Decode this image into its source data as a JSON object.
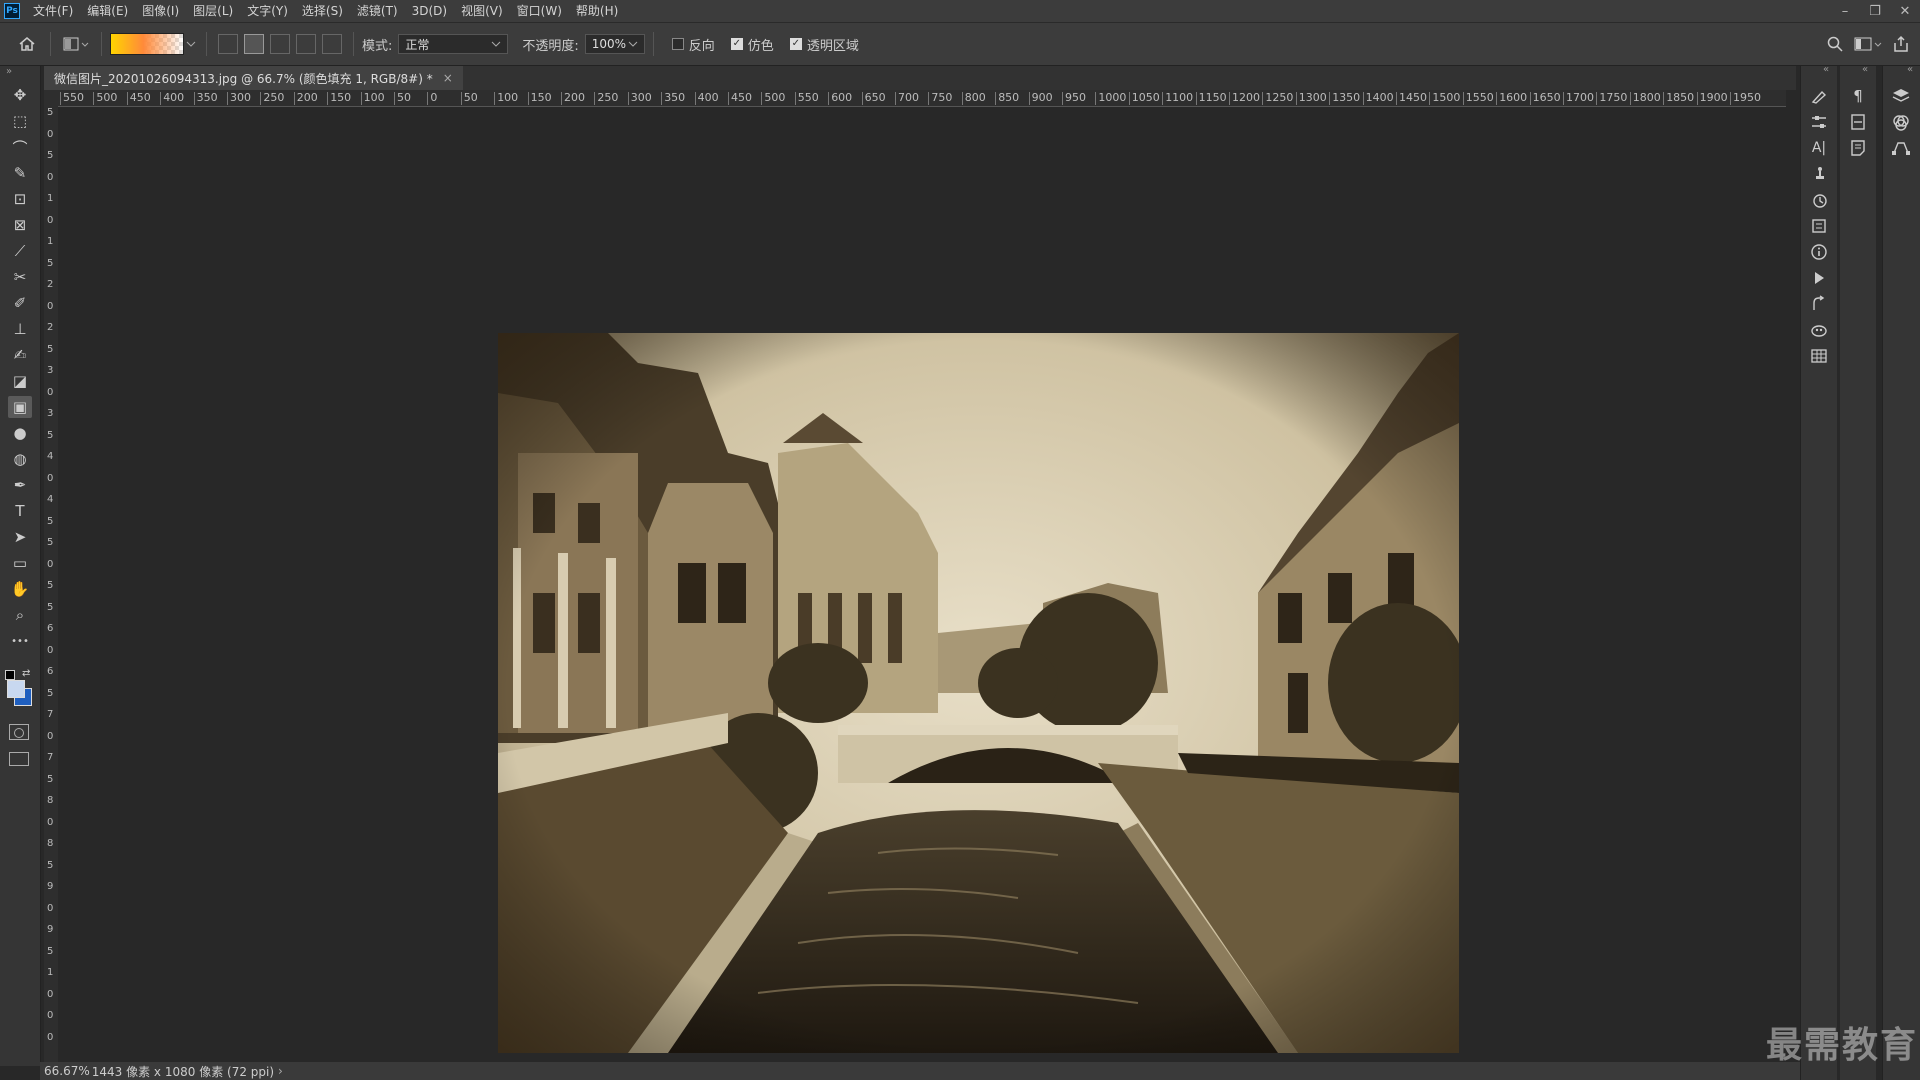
{
  "app": {
    "logo_text": "Ps"
  },
  "menu": {
    "items": [
      "文件(F)",
      "编辑(E)",
      "图像(I)",
      "图层(L)",
      "文字(Y)",
      "选择(S)",
      "滤镜(T)",
      "3D(D)",
      "视图(V)",
      "窗口(W)",
      "帮助(H)"
    ]
  },
  "window_controls": {
    "minimize": "–",
    "restore": "❐",
    "close": "✕"
  },
  "options": {
    "mode_label": "模式:",
    "mode_value": "正常",
    "opacity_label": "不透明度:",
    "opacity_value": "100%",
    "reverse_label": "反向",
    "reverse_checked": false,
    "dither_label": "仿色",
    "dither_checked": true,
    "transparency_label": "透明区域",
    "transparency_checked": true,
    "gradient_colors": [
      "#ffd400",
      "#ff8a3a",
      "transparent"
    ]
  },
  "document": {
    "tab_title": "微信图片_20201026094313.jpg @ 66.7% (颜色填充 1, RGB/8#) *",
    "close_glyph": "×"
  },
  "rulers": {
    "horizontal": [
      "550",
      "500",
      "450",
      "400",
      "350",
      "300",
      "250",
      "200",
      "150",
      "100",
      "50",
      "0",
      "50",
      "100",
      "150",
      "200",
      "250",
      "300",
      "350",
      "400",
      "450",
      "500",
      "550",
      "600",
      "650",
      "700",
      "750",
      "800",
      "850",
      "900",
      "950",
      "1000",
      "1050",
      "1100",
      "1150",
      "1200",
      "1250",
      "1300",
      "1350",
      "1400",
      "1450",
      "1500",
      "1550",
      "1600",
      "1650",
      "1700",
      "1750",
      "1800",
      "1850",
      "1900",
      "1950"
    ],
    "vertical": [
      "5",
      "0",
      "5",
      "0",
      "1",
      "0",
      "1",
      "5",
      "2",
      "0",
      "2",
      "5",
      "3",
      "0",
      "3",
      "5",
      "4",
      "0",
      "4",
      "5",
      "5",
      "0",
      "5",
      "5",
      "6",
      "0",
      "6",
      "5",
      "7",
      "0",
      "7",
      "5",
      "8",
      "0",
      "8",
      "5",
      "9",
      "0",
      "9",
      "5",
      "1",
      "0",
      "0",
      "0"
    ]
  },
  "tools": [
    {
      "name": "move-tool-icon",
      "glyph": "✥"
    },
    {
      "name": "marquee-tool-icon",
      "glyph": "⬚"
    },
    {
      "name": "lasso-tool-icon",
      "glyph": "⌒"
    },
    {
      "name": "quick-select-tool-icon",
      "glyph": "✎"
    },
    {
      "name": "crop-tool-icon",
      "glyph": "⊡"
    },
    {
      "name": "frame-tool-icon",
      "glyph": "⊠"
    },
    {
      "name": "eyedropper-tool-icon",
      "glyph": "⟋"
    },
    {
      "name": "healing-tool-icon",
      "glyph": "✂"
    },
    {
      "name": "brush-tool-icon",
      "glyph": "✐"
    },
    {
      "name": "stamp-tool-icon",
      "glyph": "⊥"
    },
    {
      "name": "history-brush-tool-icon",
      "glyph": "✍"
    },
    {
      "name": "eraser-tool-icon",
      "glyph": "◪"
    },
    {
      "name": "gradient-tool-icon",
      "glyph": "▣"
    },
    {
      "name": "blur-tool-icon",
      "glyph": "●"
    },
    {
      "name": "dodge-tool-icon",
      "glyph": "◍"
    },
    {
      "name": "pen-tool-icon",
      "glyph": "✒"
    },
    {
      "name": "type-tool-icon",
      "glyph": "T"
    },
    {
      "name": "path-select-tool-icon",
      "glyph": "➤"
    },
    {
      "name": "rectangle-tool-icon",
      "glyph": "▭"
    },
    {
      "name": "hand-tool-icon",
      "glyph": "✋"
    },
    {
      "name": "zoom-tool-icon",
      "glyph": "⌕"
    },
    {
      "name": "more-tools-icon",
      "glyph": "•••"
    }
  ],
  "status": {
    "zoom": "66.67%",
    "info": "1443 像素 x 1080 像素 (72 ppi)",
    "arrow": "›"
  },
  "watermark": "最需教育",
  "colors": {
    "foreground": "#c8d8f0",
    "background": "#1f5fbf",
    "accent": "#31a8ff"
  }
}
